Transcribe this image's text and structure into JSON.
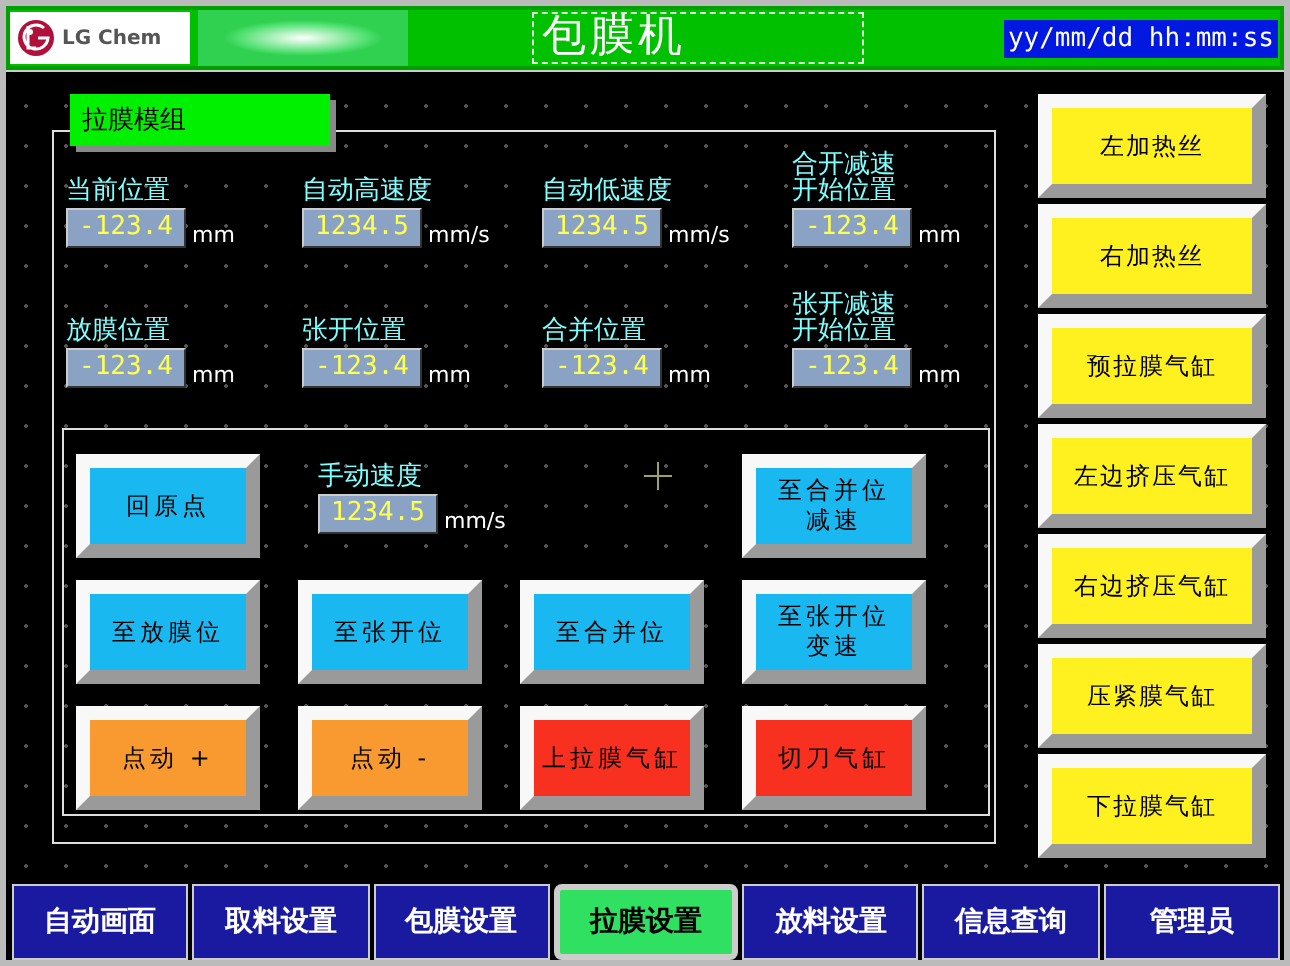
{
  "header": {
    "logo": "LG Chem",
    "title": "包膜机",
    "datetime": "yy/mm/dd hh:mm:ss"
  },
  "group": {
    "title": "拉膜模组",
    "readouts": [
      {
        "label": "当前位置",
        "value": "-123.4",
        "unit": "mm"
      },
      {
        "label": "自动高速度",
        "value": "1234.5",
        "unit": "mm/s"
      },
      {
        "label": "自动低速度",
        "value": "1234.5",
        "unit": "mm/s"
      },
      {
        "label": "合开减速开始位置",
        "value": "-123.4",
        "unit": "mm"
      },
      {
        "label": "放膜位置",
        "value": "-123.4",
        "unit": "mm"
      },
      {
        "label": "张开位置",
        "value": "-123.4",
        "unit": "mm"
      },
      {
        "label": "合并位置",
        "value": "-123.4",
        "unit": "mm"
      },
      {
        "label": "张开减速开始位置",
        "value": "-123.4",
        "unit": "mm"
      }
    ],
    "manual": {
      "label": "手动速度",
      "value": "1234.5",
      "unit": "mm/s"
    },
    "buttons": [
      {
        "label": "回原点",
        "color": "#19b8f0"
      },
      {
        "label": "至合并位减速",
        "color": "#19b8f0"
      },
      {
        "label": "至放膜位",
        "color": "#19b8f0"
      },
      {
        "label": "至张开位",
        "color": "#19b8f0"
      },
      {
        "label": "至合并位",
        "color": "#19b8f0"
      },
      {
        "label": "至张开位变速",
        "color": "#19b8f0"
      },
      {
        "label": "点动 +",
        "color": "#f89a30"
      },
      {
        "label": "点动 -",
        "color": "#f89a30"
      },
      {
        "label": "上拉膜气缸",
        "color": "#f83020"
      },
      {
        "label": "切刀气缸",
        "color": "#f83020"
      }
    ]
  },
  "side_buttons": [
    {
      "label": "左加热丝"
    },
    {
      "label": "右加热丝"
    },
    {
      "label": "预拉膜气缸"
    },
    {
      "label": "左边挤压气缸"
    },
    {
      "label": "右边挤压气缸"
    },
    {
      "label": "压紧膜气缸"
    },
    {
      "label": "下拉膜气缸"
    }
  ],
  "tabs": [
    {
      "label": "自动画面",
      "selected": false
    },
    {
      "label": "取料设置",
      "selected": false
    },
    {
      "label": "包膜设置",
      "selected": false
    },
    {
      "label": "拉膜设置",
      "selected": true
    },
    {
      "label": "放料设置",
      "selected": false
    },
    {
      "label": "信息查询",
      "selected": false
    },
    {
      "label": "管理员",
      "selected": false
    }
  ]
}
